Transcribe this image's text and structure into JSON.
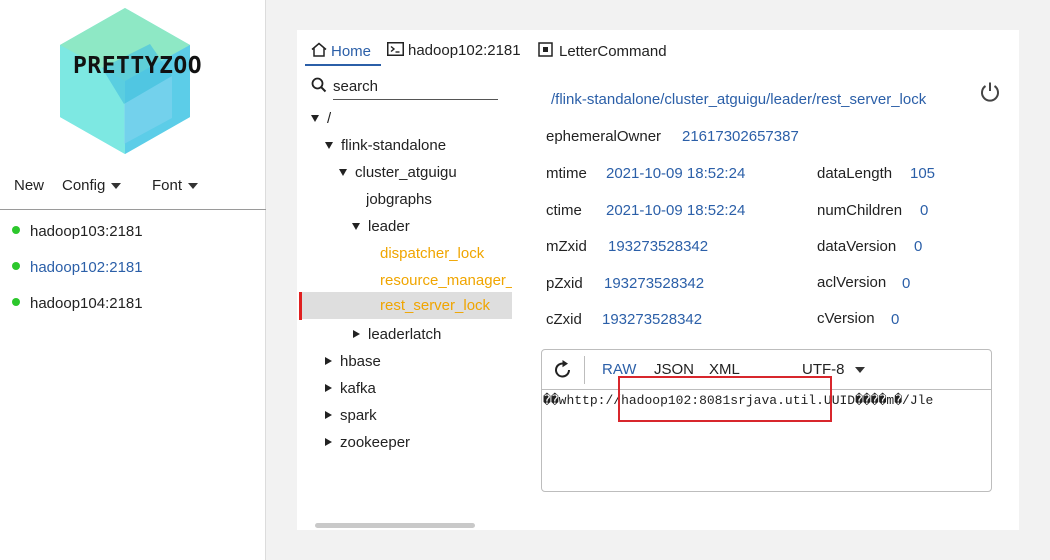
{
  "app": {
    "logo_text": "PRETTYZOO",
    "colors": {
      "accent": "#2b5fa8",
      "leaf": "#f0a500",
      "online": "#2cc72c",
      "highlight": "#d8262c"
    }
  },
  "sidebar": {
    "menu": [
      {
        "label": "New",
        "has_dropdown": false
      },
      {
        "label": "Config",
        "has_dropdown": true
      },
      {
        "label": "Font",
        "has_dropdown": true
      }
    ],
    "servers": [
      {
        "name": "hadoop103:2181",
        "status": "online",
        "active": false
      },
      {
        "name": "hadoop102:2181",
        "status": "online",
        "active": true
      },
      {
        "name": "hadoop104:2181",
        "status": "online",
        "active": false
      }
    ]
  },
  "tabs": [
    {
      "label": "Home",
      "icon": "home-icon",
      "active": true
    },
    {
      "label": "hadoop102:2181",
      "icon": "terminal-icon",
      "active": false
    },
    {
      "label": "LetterCommand",
      "icon": "command-icon",
      "active": false
    }
  ],
  "search": {
    "placeholder": "search",
    "value": ""
  },
  "tree": [
    {
      "label": "/",
      "state": "expanded"
    },
    {
      "label": "flink-standalone",
      "state": "expanded"
    },
    {
      "label": "cluster_atguigu",
      "state": "expanded"
    },
    {
      "label": "jobgraphs",
      "state": "none"
    },
    {
      "label": "leader",
      "state": "expanded"
    },
    {
      "label": "dispatcher_lock",
      "state": "leaf"
    },
    {
      "label": "resource_manager_l",
      "state": "leaf"
    },
    {
      "label": "rest_server_lock",
      "state": "leaf",
      "selected": true
    },
    {
      "label": "leaderlatch",
      "state": "collapsed"
    },
    {
      "label": "hbase",
      "state": "collapsed"
    },
    {
      "label": "kafka",
      "state": "collapsed"
    },
    {
      "label": "spark",
      "state": "collapsed"
    },
    {
      "label": "zookeeper",
      "state": "collapsed"
    }
  ],
  "node": {
    "path": "/flink-standalone/cluster_atguigu/leader/rest_server_lock",
    "ephemeralOwner": {
      "label": "ephemeralOwner",
      "value": "21617302657387"
    },
    "mtime": {
      "label": "mtime",
      "value": "2021-10-09 18:52:24"
    },
    "ctime": {
      "label": "ctime",
      "value": "2021-10-09 18:52:24"
    },
    "mZxid": {
      "label": "mZxid",
      "value": "193273528342"
    },
    "pZxid": {
      "label": "pZxid",
      "value": "193273528342"
    },
    "cZxid": {
      "label": "cZxid",
      "value": "193273528342"
    },
    "dataLength": {
      "label": "dataLength",
      "value": "105"
    },
    "numChildren": {
      "label": "numChildren",
      "value": "0"
    },
    "dataVersion": {
      "label": "dataVersion",
      "value": "0"
    },
    "aclVersion": {
      "label": "aclVersion",
      "value": "0"
    },
    "cVersion": {
      "label": "cVersion",
      "value": "0"
    }
  },
  "editor": {
    "formats": [
      "RAW",
      "JSON",
      "XML"
    ],
    "active_format": "RAW",
    "encoding": "UTF-8",
    "content": "��whttp://hadoop102:8081srjava.util.UUID����m�/Jle"
  }
}
